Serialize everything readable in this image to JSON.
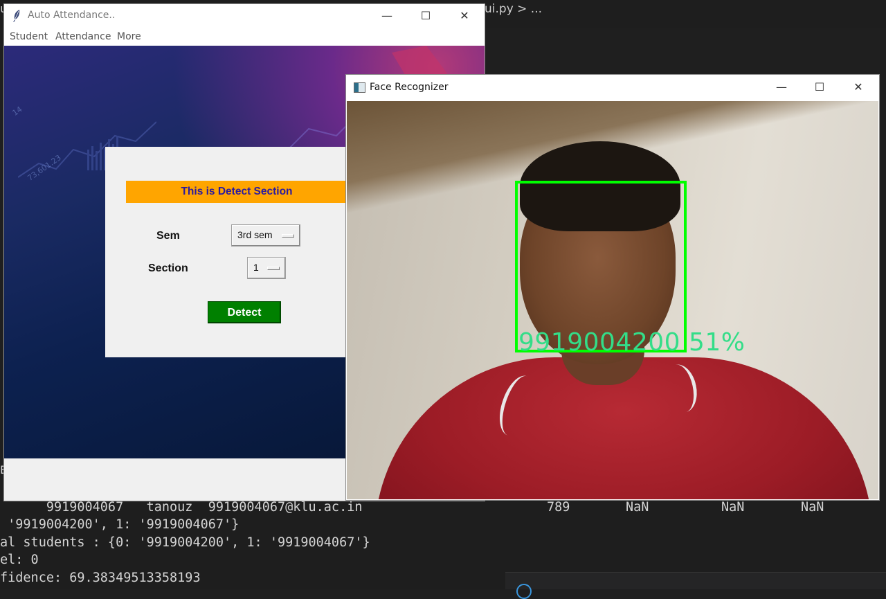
{
  "editor": {
    "breadcrumb": "ui.py > ...",
    "left_partial_top": "u",
    "left_partial_edge": "E"
  },
  "terminal": {
    "lines": [
      "      9919004067   tanouz  9919004067@klu.ac.in",
      " '9919004200', 1: '9919004067'}",
      "al students : {0: '9919004200', 1: '9919004067'}",
      "el: 0",
      "fidence: 69.38349513358193"
    ],
    "row_values": [
      "789",
      "NaN",
      "NaN",
      "NaN"
    ]
  },
  "auto_window": {
    "title": "Auto Attendance..",
    "menu": [
      "Student",
      "Attendance",
      "More"
    ],
    "bg_numbers": [
      "14",
      "73,601.23"
    ],
    "detect": {
      "header": "This is Detect Section",
      "sem_label": "Sem",
      "sem_value": "3rd sem",
      "section_label": "Section",
      "section_value": "1",
      "button": "Detect"
    },
    "colors": {
      "header_bg": "#ffa500",
      "header_text": "#2a1aa0",
      "button_bg": "#008000"
    }
  },
  "face_window": {
    "title": "Face Recognizer",
    "label": "9919004200 51%",
    "box_color": "#00ff00"
  },
  "window_controls": {
    "minimize": "—",
    "maximize": "☐",
    "close": "✕"
  }
}
